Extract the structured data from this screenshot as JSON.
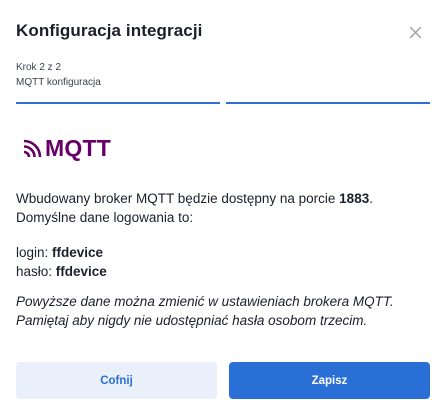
{
  "dialog": {
    "title": "Konfiguracja integracji",
    "close_icon": "close-icon"
  },
  "stepper": {
    "step_text": "Krok 2 z 2",
    "step_name": "MQTT konfiguracja",
    "total_steps": 2,
    "completed_steps": 2,
    "accent_color": "#2a70d8"
  },
  "logo": {
    "icon": "mqtt-signal-icon",
    "text": "MQTT",
    "color": "#660066"
  },
  "content": {
    "intro_prefix": "Wbudowany broker MQTT będzie dostępny na porcie ",
    "port": "1883",
    "intro_suffix": ". Domyślne dane logowania to:",
    "login_label": "login: ",
    "login_value": "ffdevice",
    "password_label": "hasło: ",
    "password_value": "ffdevice",
    "note": "Powyższe dane można zmienić w ustawieniach brokera MQTT. Pamiętaj aby nigdy nie udostępniać hasła osobom trzecim."
  },
  "actions": {
    "back_label": "Cofnij",
    "save_label": "Zapisz"
  }
}
